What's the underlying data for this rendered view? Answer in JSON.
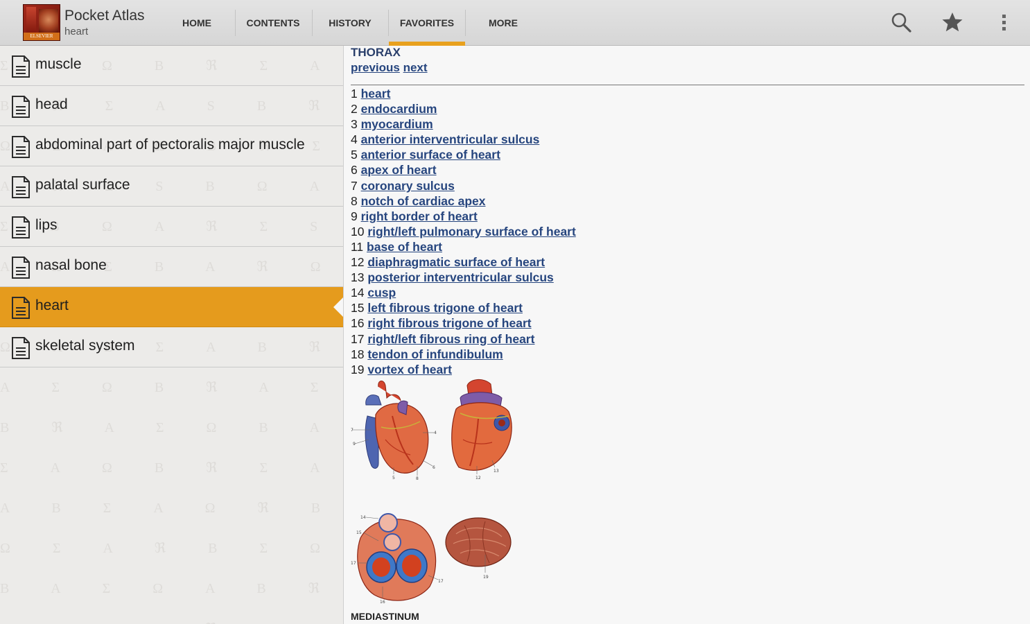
{
  "app": {
    "title": "Pocket Atlas",
    "subtitle": "heart",
    "icon_caption": "ELSEVIER"
  },
  "tabs": [
    {
      "label": "HOME",
      "active": false
    },
    {
      "label": "CONTENTS",
      "active": false
    },
    {
      "label": "HISTORY",
      "active": false
    },
    {
      "label": "FAVORITES",
      "active": true
    },
    {
      "label": "MORE",
      "active": false
    }
  ],
  "actions": [
    {
      "name": "search-icon"
    },
    {
      "name": "star-icon"
    },
    {
      "name": "overflow-menu-icon"
    }
  ],
  "list": {
    "items": [
      {
        "label": "muscle",
        "selected": false
      },
      {
        "label": "head",
        "selected": false
      },
      {
        "label": "abdominal part of pectoralis major muscle",
        "selected": false
      },
      {
        "label": "palatal surface",
        "selected": false
      },
      {
        "label": "lips",
        "selected": false
      },
      {
        "label": "nasal bone",
        "selected": false
      },
      {
        "label": "heart",
        "selected": true
      },
      {
        "label": "skeletal system",
        "selected": false
      }
    ],
    "accent_color": "#e59b1d"
  },
  "content": {
    "section": "THORAX",
    "previous_label": "previous",
    "next_label": "next",
    "terms": [
      {
        "num": "1",
        "text": "heart"
      },
      {
        "num": "2",
        "text": "endocardium"
      },
      {
        "num": "3",
        "text": "myocardium"
      },
      {
        "num": "4",
        "text": "anterior interventricular sulcus"
      },
      {
        "num": "5",
        "text": "anterior surface of heart"
      },
      {
        "num": "6",
        "text": "apex of heart"
      },
      {
        "num": "7",
        "text": "coronary sulcus"
      },
      {
        "num": "8",
        "text": "notch of cardiac apex"
      },
      {
        "num": "9",
        "text": "right border of heart"
      },
      {
        "num": "10",
        "text": "right/left pulmonary surface of heart"
      },
      {
        "num": "11",
        "text": "base of heart"
      },
      {
        "num": "12",
        "text": "diaphragmatic surface of heart"
      },
      {
        "num": "13",
        "text": "posterior interventricular sulcus"
      },
      {
        "num": "14",
        "text": "cusp"
      },
      {
        "num": "15",
        "text": "left fibrous trigone of heart"
      },
      {
        "num": "16",
        "text": "right fibrous trigone of heart"
      },
      {
        "num": "17",
        "text": "right/left fibrous ring of heart"
      },
      {
        "num": "18",
        "text": "tendon of infundibulum"
      },
      {
        "num": "19",
        "text": "vortex of heart"
      }
    ],
    "figure_labels": [
      "7",
      "4",
      "9",
      "5",
      "8",
      "6",
      "12",
      "13",
      "14",
      "15",
      "17",
      "17",
      "16",
      "19"
    ],
    "footer": "MEDIASTINUM",
    "link_color": "#26457e"
  }
}
